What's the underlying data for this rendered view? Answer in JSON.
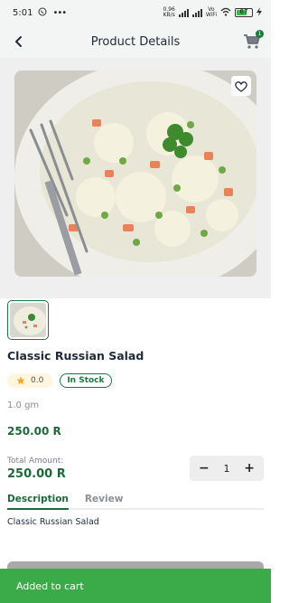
{
  "status_bar": {
    "time": "5:01",
    "net_speed_value": "0.96",
    "net_speed_unit": "KB/s",
    "volte": "Vo",
    "wifi_label": "WiFi",
    "battery": "67"
  },
  "header": {
    "title": "Product Details",
    "cart_count": "1"
  },
  "product": {
    "name": "Classic Russian Salad",
    "rating": "0.0",
    "stock_label": "In Stock",
    "weight": "1.0 gm",
    "price": "250.00 R"
  },
  "total": {
    "label": "Total Amount:",
    "value": "250.00 R",
    "quantity": "1",
    "minus": "−",
    "plus": "+"
  },
  "tabs": [
    {
      "label": "Description",
      "active": true
    },
    {
      "label": "Review",
      "active": false
    }
  ],
  "description_text": "Classic Russian Salad",
  "snackbar": {
    "message": "Added to cart"
  },
  "colors": {
    "accent": "#1a6b38",
    "snackbar": "#3bab4a",
    "rating_bg": "#fff6e0"
  }
}
